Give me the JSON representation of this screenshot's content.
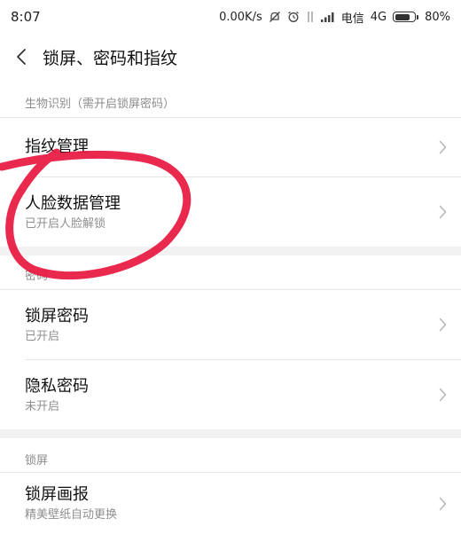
{
  "status_bar": {
    "time": "8:07",
    "net_speed": "0.00K/s",
    "carrier": "电信",
    "network_type": "4G",
    "battery_percent": "80%",
    "battery_level": 0.8
  },
  "header": {
    "title": "锁屏、密码和指纹"
  },
  "sections": {
    "biometrics_header": "生物识别（需开启锁屏密码）",
    "password_header": "密码",
    "lockscreen_header": "锁屏"
  },
  "items": {
    "fingerprint": {
      "label": "指纹管理"
    },
    "face": {
      "label": "人脸数据管理",
      "sub": "已开启人脸解锁"
    },
    "lock_password": {
      "label": "锁屏密码",
      "sub": "已开启"
    },
    "privacy_password": {
      "label": "隐私密码",
      "sub": "未开启"
    },
    "lockscreen_pictorial": {
      "label": "锁屏画报",
      "sub": "精美壁纸自动更换"
    }
  },
  "colors": {
    "annotation": "#e8173f",
    "secondary_text": "#8f8f8f",
    "chevron": "#b8b8b8"
  }
}
